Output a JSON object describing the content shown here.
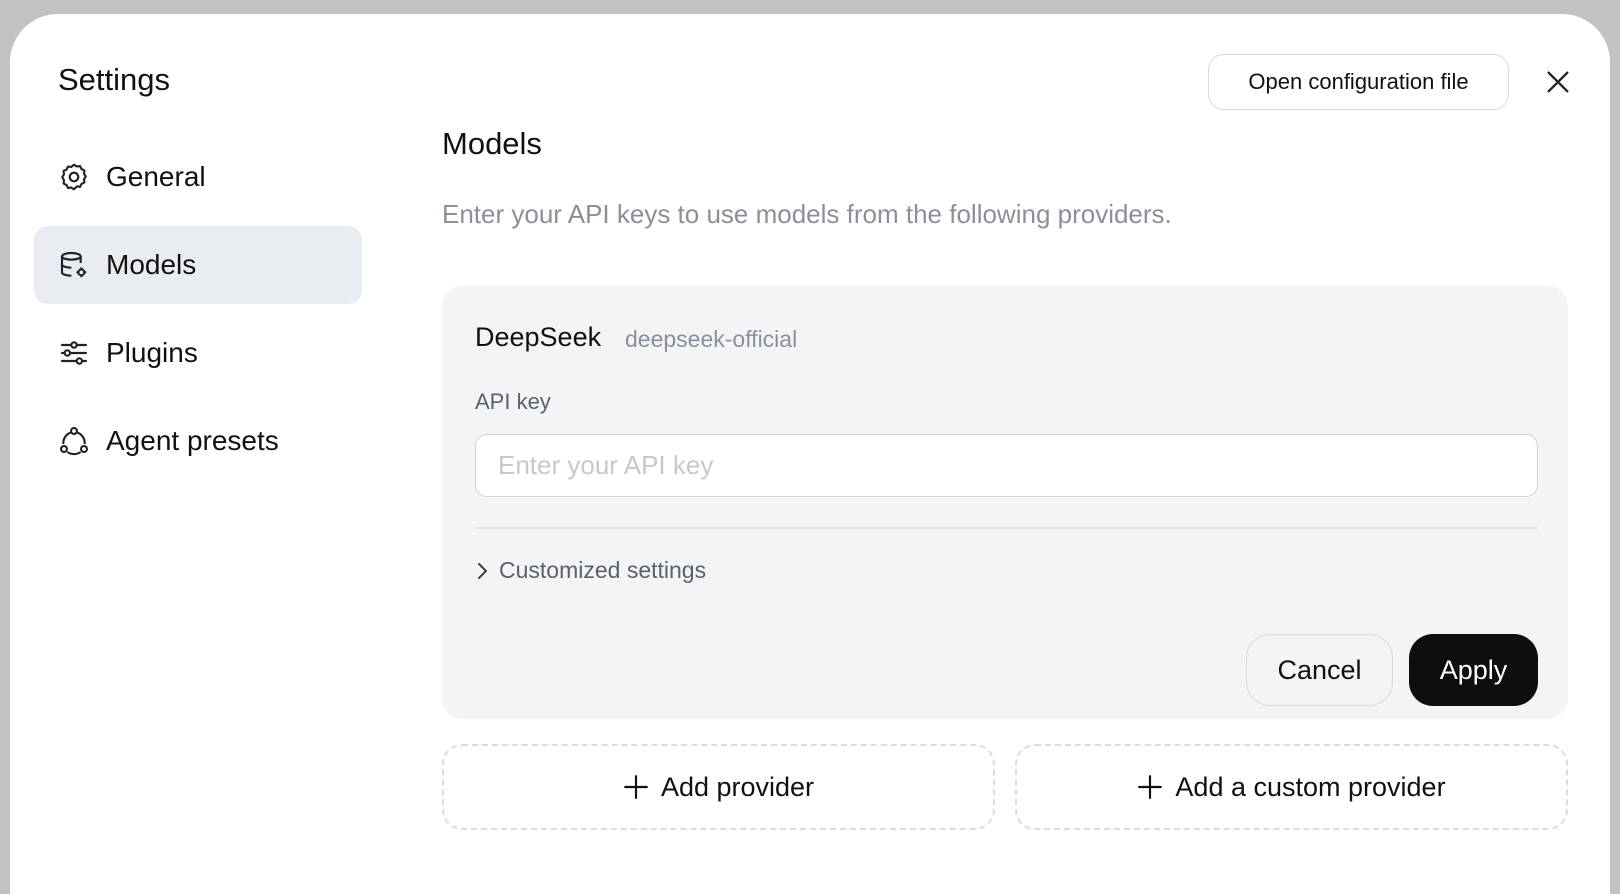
{
  "window": {
    "title": "Settings"
  },
  "header": {
    "open_config_label": "Open configuration file",
    "close_icon": "close-icon"
  },
  "sidebar": {
    "items": [
      {
        "label": "General",
        "icon": "gear-icon",
        "active": false
      },
      {
        "label": "Models",
        "icon": "database-settings-icon",
        "active": true
      },
      {
        "label": "Plugins",
        "icon": "sliders-icon",
        "active": false
      },
      {
        "label": "Agent presets",
        "icon": "agent-network-icon",
        "active": false
      }
    ]
  },
  "main": {
    "title": "Models",
    "description": "Enter your API keys to use models from the following providers.",
    "provider": {
      "name": "DeepSeek",
      "id": "deepseek-official",
      "api_key_label": "API key",
      "api_key_value": "",
      "api_key_placeholder": "Enter your API key",
      "customized_label": "Customized settings",
      "cancel_label": "Cancel",
      "apply_label": "Apply"
    },
    "add_provider_label": "Add provider",
    "add_custom_provider_label": "Add a custom provider"
  },
  "colors": {
    "background": "#c2c2c2",
    "active_nav": "#e9edf2",
    "card": "#f3f4f6",
    "primary_button": "#0d0e10",
    "muted_text": "#8a9099"
  }
}
